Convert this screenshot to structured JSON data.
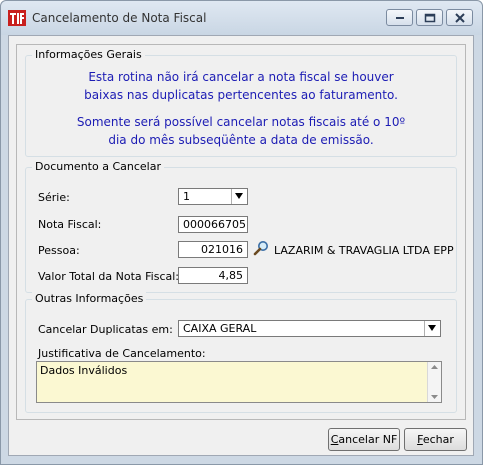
{
  "window": {
    "title": "Cancelamento de Nota Fiscal",
    "app_icon": "app-logo-icon",
    "controls": [
      "minimize-icon",
      "restore-icon",
      "close-icon"
    ]
  },
  "general_info": {
    "legend": "Informações Gerais",
    "line1": "Esta rotina não irá cancelar a nota fiscal se houver",
    "line2": "baixas nas duplicatas pertencentes ao faturamento.",
    "line3": "Somente será possível cancelar notas fiscais até o 10º",
    "line4": "dia do mês subseqüênte a data de emissão.",
    "text_color": "#1c1cb4"
  },
  "document": {
    "legend": "Documento a Cancelar",
    "serie_label": "Série:",
    "serie_value": "1",
    "nota_label": "Nota Fiscal:",
    "nota_value": "000066705",
    "pessoa_label": "Pessoa:",
    "pessoa_code": "021016",
    "pessoa_name": "LAZARIM & TRAVAGLIA LTDA EPP",
    "search_icon": "magnifier-icon",
    "valor_label": "Valor Total da Nota Fiscal:",
    "valor_value": "4,85"
  },
  "other": {
    "legend": "Outras Informações",
    "duplicatas_label": "Cancelar Duplicatas em:",
    "duplicatas_value": "CAIXA GERAL",
    "justificativa_label": "Justificativa de Cancelamento:",
    "justificativa_value": "Dados Inválidos",
    "memo_color": "#fbf8d2"
  },
  "buttons": {
    "cancel_nf_prefix": "",
    "cancel_nf_mnemonic": "C",
    "cancel_nf_rest": "ancelar NF",
    "close_mnemonic": "F",
    "close_rest": "echar"
  }
}
